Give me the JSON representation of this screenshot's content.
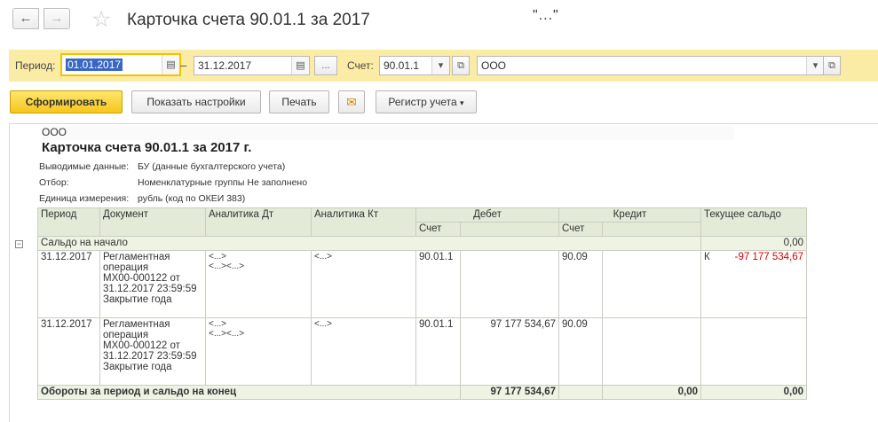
{
  "window": {
    "title": "Карточка счета 90.01.1 за 2017",
    "title_tail": "\"...\"",
    "back_icon": "arrow-left-icon",
    "forward_icon": "arrow-right-icon",
    "star_icon": "star-icon"
  },
  "filters": {
    "period_label": "Период:",
    "date_from": "01.01.2017",
    "dash": "–",
    "date_to": "31.12.2017",
    "choose_period": "...",
    "account_label": "Счет:",
    "account": "90.01.1",
    "organization": "ООО"
  },
  "toolbar": {
    "generate": "Сформировать",
    "show_settings": "Показать настройки",
    "print": "Печать",
    "register": "Регистр учета",
    "mail_icon": "envelope-icon"
  },
  "report": {
    "org": "ООО",
    "title": "Карточка счета 90.01.1 за 2017 г.",
    "meta": [
      {
        "label": "Выводимые данные:",
        "value": "БУ (данные бухгалтерского учета)"
      },
      {
        "label": "Отбор:",
        "value": "Номенклатурные группы Не заполнено"
      },
      {
        "label": "Единица измерения:",
        "value": "рубль (код по ОКЕИ 383)"
      }
    ],
    "headers": {
      "period": "Период",
      "document": "Документ",
      "analytics_dt": "Аналитика Дт",
      "analytics_kt": "Аналитика Кт",
      "debit": "Дебет",
      "credit": "Кредит",
      "balance": "Текущее сальдо",
      "account_sub": "Счет"
    },
    "opening": {
      "label": "Сальдо на начало",
      "value": "0,00"
    },
    "rows": [
      {
        "period": "31.12.2017",
        "document": [
          "Регламентная",
          "операция",
          "МХ00-000122 от",
          "31.12.2017 23:59:59",
          "Закрытие года"
        ],
        "adt": [
          "<...>",
          "<...><...>"
        ],
        "akt": "<...>",
        "debit_acc": "90.01.1",
        "debit_sum": "",
        "credit_acc": "90.09",
        "credit_sum": "",
        "balance_side": "К",
        "balance": "-97 177 534,67"
      },
      {
        "period": "31.12.2017",
        "document": [
          "Регламентная",
          "операция",
          "МХ00-000122 от",
          "31.12.2017 23:59:59",
          "Закрытие года"
        ],
        "adt": [
          "<...>",
          "<...><...>"
        ],
        "akt": "<...>",
        "debit_acc": "90.01.1",
        "debit_sum": "97 177 534,67",
        "credit_acc": "90.09",
        "credit_sum": "",
        "balance_side": "",
        "balance": ""
      }
    ],
    "totals": {
      "label": "Обороты за период и сальдо на конец",
      "debit": "97 177 534,67",
      "credit": "0,00",
      "balance": "0,00"
    }
  }
}
